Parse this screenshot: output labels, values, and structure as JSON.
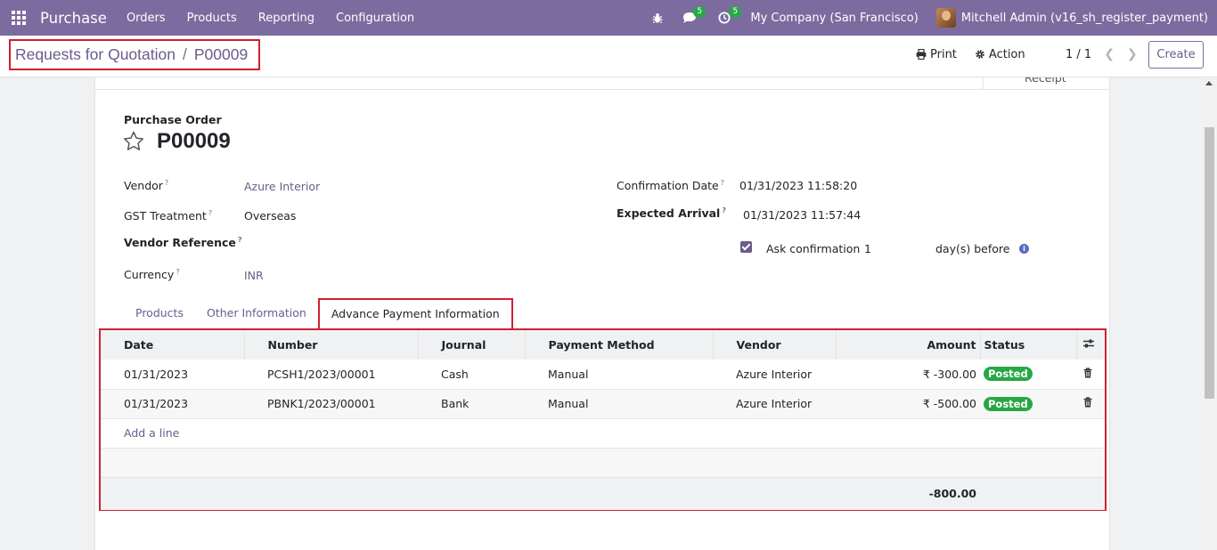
{
  "navbar": {
    "app_name": "Purchase",
    "menus": [
      "Orders",
      "Products",
      "Reporting",
      "Configuration"
    ],
    "messages_count": "5",
    "activities_count": "5",
    "company": "My Company (San Francisco)",
    "user": "Mitchell Admin (v16_sh_register_payment)",
    "accent_color": "#7c6b9f"
  },
  "control_panel": {
    "breadcrumb_parent": "Requests for Quotation",
    "breadcrumb_separator": "/",
    "breadcrumb_current": "P00009",
    "print_label": "Print",
    "action_label": "Action",
    "pager": "1 / 1",
    "create_label": "Create"
  },
  "smart_button": {
    "label": "Receipt"
  },
  "form": {
    "doc_type": "Purchase Order",
    "name": "P00009",
    "vendor_label": "Vendor",
    "vendor_value": "Azure Interior",
    "gst_label": "GST Treatment",
    "gst_value": "Overseas",
    "vendor_ref_label": "Vendor Reference",
    "currency_label": "Currency",
    "currency_value": "INR",
    "confirmation_date_label": "Confirmation Date",
    "confirmation_date_value": "01/31/2023 11:58:20",
    "expected_arrival_label": "Expected Arrival",
    "expected_arrival_value": "01/31/2023 11:57:44",
    "ask_confirmation_label": "Ask confirmation",
    "ask_confirmation_days": "1",
    "days_before_label": "day(s) before",
    "help_mark": "?"
  },
  "tabs": [
    "Products",
    "Other Information",
    "Advance Payment Information"
  ],
  "payments_table": {
    "columns": [
      "Date",
      "Number",
      "Journal",
      "Payment Method",
      "Vendor",
      "Amount",
      "Status"
    ],
    "rows": [
      {
        "date": "01/31/2023",
        "number": "PCSH1/2023/00001",
        "journal": "Cash",
        "method": "Manual",
        "vendor": "Azure Interior",
        "amount": "₹ -300.00",
        "status": "Posted"
      },
      {
        "date": "01/31/2023",
        "number": "PBNK1/2023/00001",
        "journal": "Bank",
        "method": "Manual",
        "vendor": "Azure Interior",
        "amount": "₹ -500.00",
        "status": "Posted"
      }
    ],
    "add_line_label": "Add a line",
    "total": "-800.00",
    "status_color": "#28a745"
  }
}
